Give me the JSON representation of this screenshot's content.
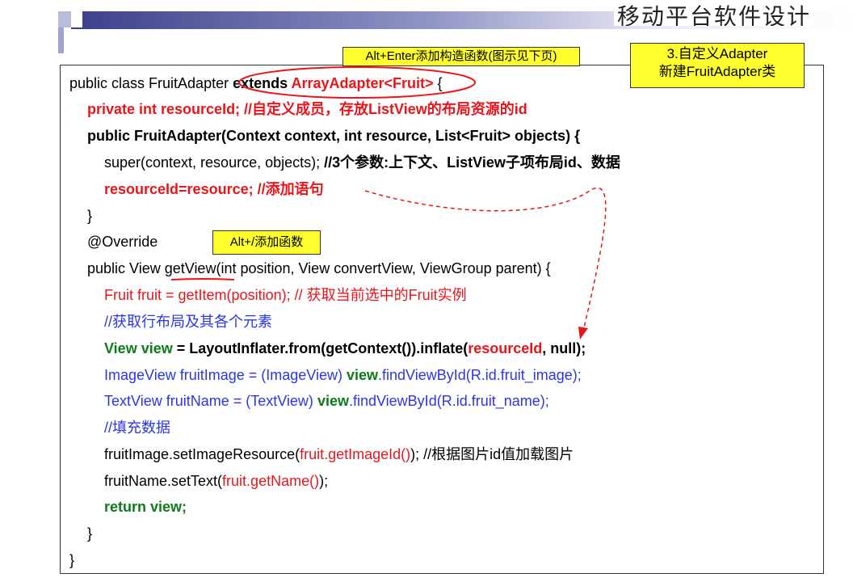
{
  "header": {
    "title": "移动平台软件设计"
  },
  "callouts": {
    "alt_enter": "Alt+Enter添加构造函数(图示见下页)",
    "adapter_line1": "3.自定义Adapter",
    "adapter_line2": "新建FruitAdapter类",
    "alt_slash": "Alt+/添加函数"
  },
  "code": {
    "l1": {
      "a": "public class FruitAdapter ",
      "b": "extends ",
      "c": "ArrayAdapter<Fruit>",
      "d": " {"
    },
    "l2": "private int resourceId;   //自定义成员，存放ListView的布局资源的id",
    "l3": "public FruitAdapter(Context context, int resource, List<Fruit> objects) {",
    "l4": {
      "a": "super(context, resource, objects);    ",
      "b": "//3个参数:上下文、ListView子项布局id、数据"
    },
    "l5": "resourceId=resource;   //添加语句",
    "l6": "}",
    "l7": "@Override",
    "l8": {
      "a": "public View ",
      "b": "getView",
      "c": "(int position, View convertView, ViewGroup parent) {"
    },
    "l9": "Fruit fruit = getItem(position);  // 获取当前选中的Fruit实例",
    "l10": "//获取行布局及其各个元素",
    "l11": {
      "a": "View view",
      "b": " = LayoutInflater.from(getContext()).inflate(",
      "c": "resourceId",
      "d": ", null);"
    },
    "l12": {
      "a": "ImageView fruitImage = (ImageView) ",
      "b": "view",
      "c": ".findViewById(R.id.fruit_image);"
    },
    "l13": {
      "a": "TextView fruitName = (TextView) ",
      "b": "view",
      "c": ".findViewById(R.id.fruit_name);"
    },
    "l14": "//填充数据",
    "l15": {
      "a": "fruitImage.setImageResource(",
      "b": "fruit.getImageId()",
      "c": ");  //根据图片id值加载图片"
    },
    "l16": {
      "a": "fruitName.setText(",
      "b": "fruit.getName()",
      "c": ");"
    },
    "l17": "return view;",
    "l18": "}",
    "l19": "}"
  },
  "colors": {
    "keyword_red": "#e8161b",
    "code_blue": "#2a37e8",
    "code_green": "#0e7a1c",
    "callout_yellow": "#ffff2e"
  }
}
